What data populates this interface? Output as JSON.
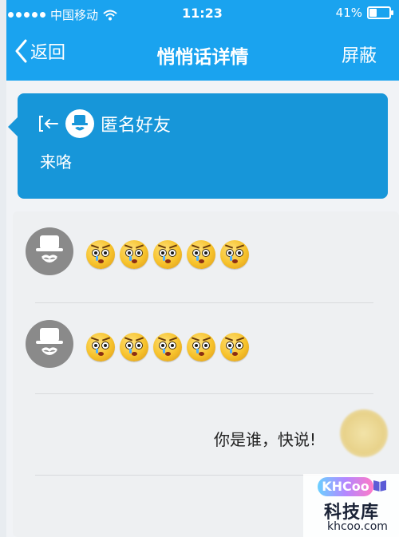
{
  "status": {
    "carrier": "中国移动",
    "time": "11:23",
    "battery": "41%",
    "battery_level": 0.41
  },
  "nav": {
    "back_label": "返回",
    "title": "悄悄话详情",
    "block_label": "屏蔽"
  },
  "card": {
    "sender": "匿名好友",
    "message": "来咯"
  },
  "replies": [
    {
      "emoji_count": 5,
      "icon": "angry-face-emoji"
    },
    {
      "emoji_count": 5,
      "icon": "angry-face-emoji"
    },
    {
      "text": "你是谁，快说!"
    }
  ],
  "watermark": {
    "logo": "KHCoo",
    "name": "科技库",
    "url": "khcoo.com"
  }
}
